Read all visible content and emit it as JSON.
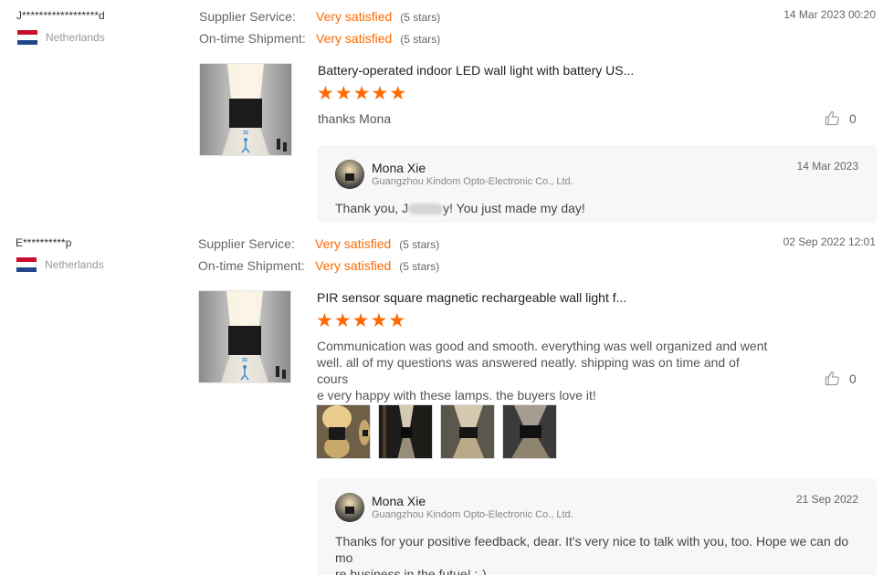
{
  "reviews": [
    {
      "buyer": "J******************d",
      "country": "Netherlands",
      "supplier_label": "Supplier Service:",
      "supplier_value": "Very satisfied",
      "supplier_stars": "(5 stars)",
      "shipment_label": "On-time Shipment:",
      "shipment_value": "Very satisfied",
      "shipment_stars": "(5 stars)",
      "date": "14 Mar 2023 00:20",
      "product_title": "Battery-operated indoor LED wall light with battery US...",
      "rating": 5,
      "text": "thanks Mona",
      "likes": "0",
      "reply": {
        "name": "Mona Xie",
        "company": "Guangzhou Kindom Opto-Electronic Co., Ltd.",
        "date": "14 Mar 2023",
        "text_before": "Thank you, J",
        "text_after": "y! You just made my day!"
      }
    },
    {
      "buyer": "E**********p",
      "country": "Netherlands",
      "supplier_label": "Supplier Service:",
      "supplier_value": "Very satisfied",
      "supplier_stars": "(5 stars)",
      "shipment_label": "On-time Shipment:",
      "shipment_value": "Very satisfied",
      "shipment_stars": "(5 stars)",
      "date": "02 Sep 2022 12:01",
      "product_title": "PIR sensor square magnetic rechargeable wall light f...",
      "rating": 5,
      "text_lines": [
        "Communication was good and smooth. everything was well organized and went",
        "well. all of my questions was answered neatly. shipping was on time and of cours",
        "e very happy with these lamps. the buyers love it!"
      ],
      "likes": "0",
      "reply": {
        "name": "Mona Xie",
        "company": "Guangzhou Kindom Opto-Electronic Co., Ltd.",
        "date": "21 Sep 2022",
        "text_lines": [
          "Thanks for your positive feedback, dear. It's very nice to talk with you, too. Hope we can do mo",
          "re business in the futue! :-)"
        ]
      }
    }
  ],
  "icons": {
    "flag": "netherlands-flag-icon",
    "like": "thumbs-up-icon",
    "star": "star-icon"
  },
  "colors": {
    "accent": "#ff6a00",
    "reply_bg": "#f7f7f7"
  }
}
